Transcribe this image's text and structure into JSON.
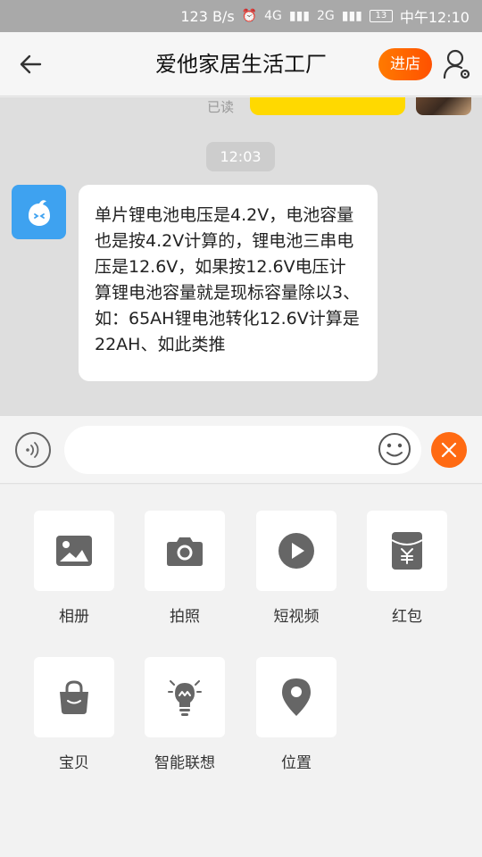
{
  "status_bar": {
    "speed": "123 B/s",
    "network_1": "4G",
    "network_2": "2G",
    "battery": "13",
    "time": "中午12:10"
  },
  "header": {
    "back_icon": "arrow-left-icon",
    "title": "爱他家居生活工厂",
    "shop_button": "进店",
    "user_icon": "user-settings-icon"
  },
  "chat": {
    "previous_read_status": "已读",
    "timestamp": "12:03",
    "message": "单片锂电池电压是4.2V，电池容量也是按4.2V计算的，锂电池三串电压是12.6V，如果按12.6V电压计算锂电池容量就是现标容量除以3、如：65AH锂电池转化12.6V计算是22AH、如此类推"
  },
  "input_bar": {
    "text_value": "",
    "placeholder": "",
    "voice_icon": "voice-icon",
    "emoji_icon": "emoji-icon",
    "close_icon": "close-icon"
  },
  "features": [
    {
      "label": "相册",
      "icon": "album-icon"
    },
    {
      "label": "拍照",
      "icon": "camera-icon"
    },
    {
      "label": "短视频",
      "icon": "video-icon"
    },
    {
      "label": "红包",
      "icon": "red-envelope-icon"
    },
    {
      "label": "宝贝",
      "icon": "bag-icon"
    },
    {
      "label": "智能联想",
      "icon": "lightbulb-icon"
    },
    {
      "label": "位置",
      "icon": "location-icon"
    }
  ],
  "colors": {
    "accent": "#ff6a12",
    "avatar": "#3ea2f0",
    "prev_bubble": "#ffd900",
    "icon_gray": "#666666"
  }
}
